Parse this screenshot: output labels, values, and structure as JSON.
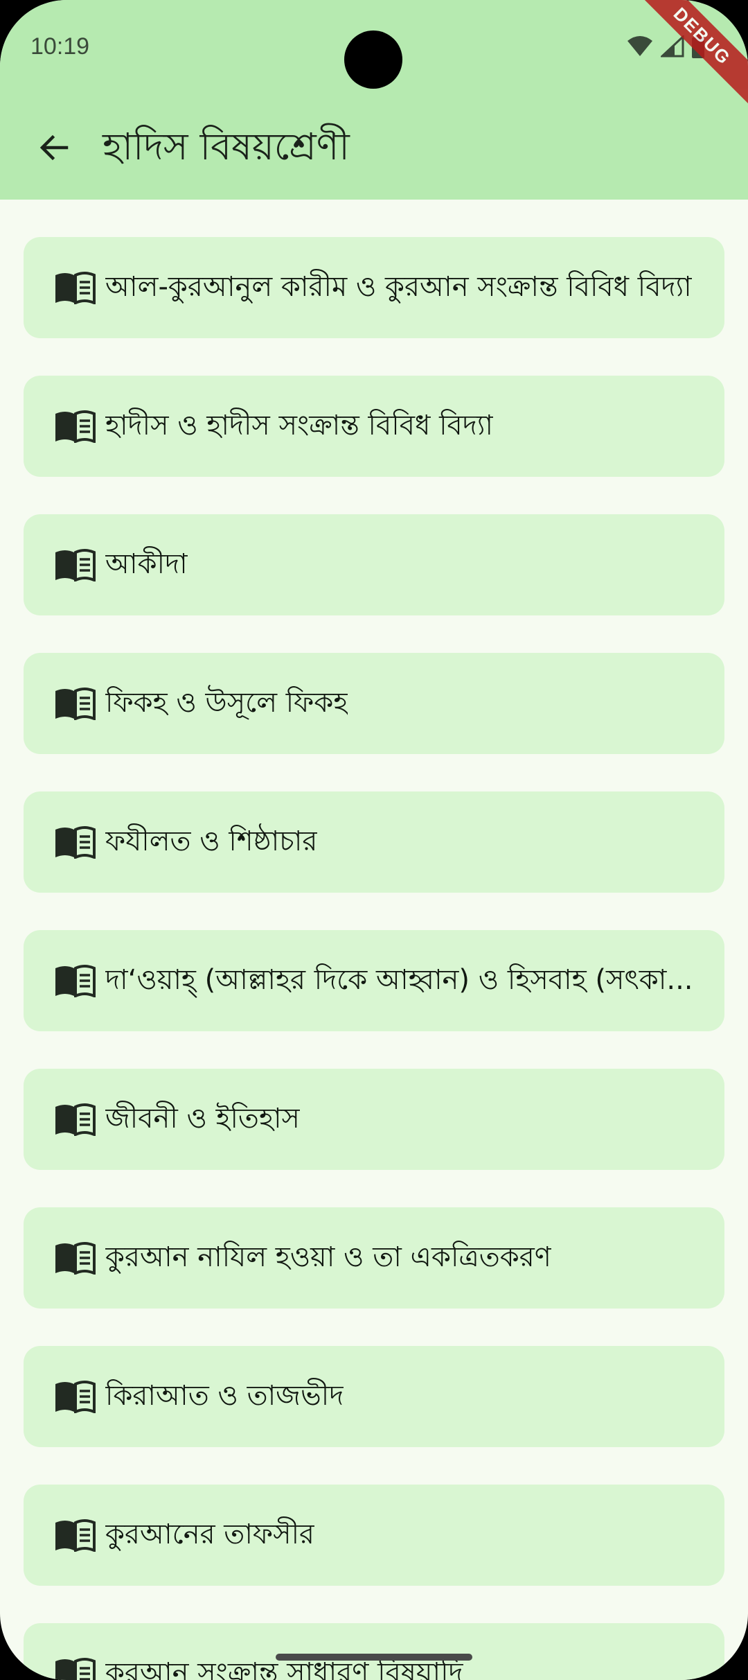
{
  "status_bar": {
    "time": "10:19",
    "icons": [
      "wifi-icon",
      "signal-icon",
      "battery-icon"
    ]
  },
  "debug_banner": "DEBUG",
  "app_bar": {
    "back_icon": "arrow-left-icon",
    "title": "হাদিস বিষয়শ্রেণী"
  },
  "categories": [
    {
      "label": "আল-কুরআনুল কারীম ও কুরআন সংক্রান্ত বিবিধ বিদ্যা",
      "icon": "book-icon"
    },
    {
      "label": "হাদীস ও হাদীস সংক্রান্ত বিবিধ বিদ্যা",
      "icon": "book-icon"
    },
    {
      "label": "আকীদা",
      "icon": "book-icon"
    },
    {
      "label": "ফিকহ ও উসূলে ফিকহ",
      "icon": "book-icon"
    },
    {
      "label": "ফযীলত ও শিষ্ঠাচার",
      "icon": "book-icon"
    },
    {
      "label": "দা‘ওয়াহ্ (আল্লাহর দিকে আহ্বান) ও হিসবাহ (সৎকা...",
      "icon": "book-icon"
    },
    {
      "label": "জীবনী ও ইতিহাস",
      "icon": "book-icon"
    },
    {
      "label": "কুরআন নাযিল হওয়া ও তা একত্রিতকরণ",
      "icon": "book-icon"
    },
    {
      "label": "কিরাআত ও তাজভীদ",
      "icon": "book-icon"
    },
    {
      "label": "কুরআনের তাফসীর",
      "icon": "book-icon"
    },
    {
      "label": "কুরআন সংক্রান্ত সাধারণ বিষয়াদি",
      "icon": "book-icon"
    }
  ],
  "colors": {
    "header_bg": "#b6eab0",
    "page_bg": "#f6fbf1",
    "card_bg": "#d9f6d2",
    "text": "#111811",
    "debug": "#b71c1c"
  }
}
